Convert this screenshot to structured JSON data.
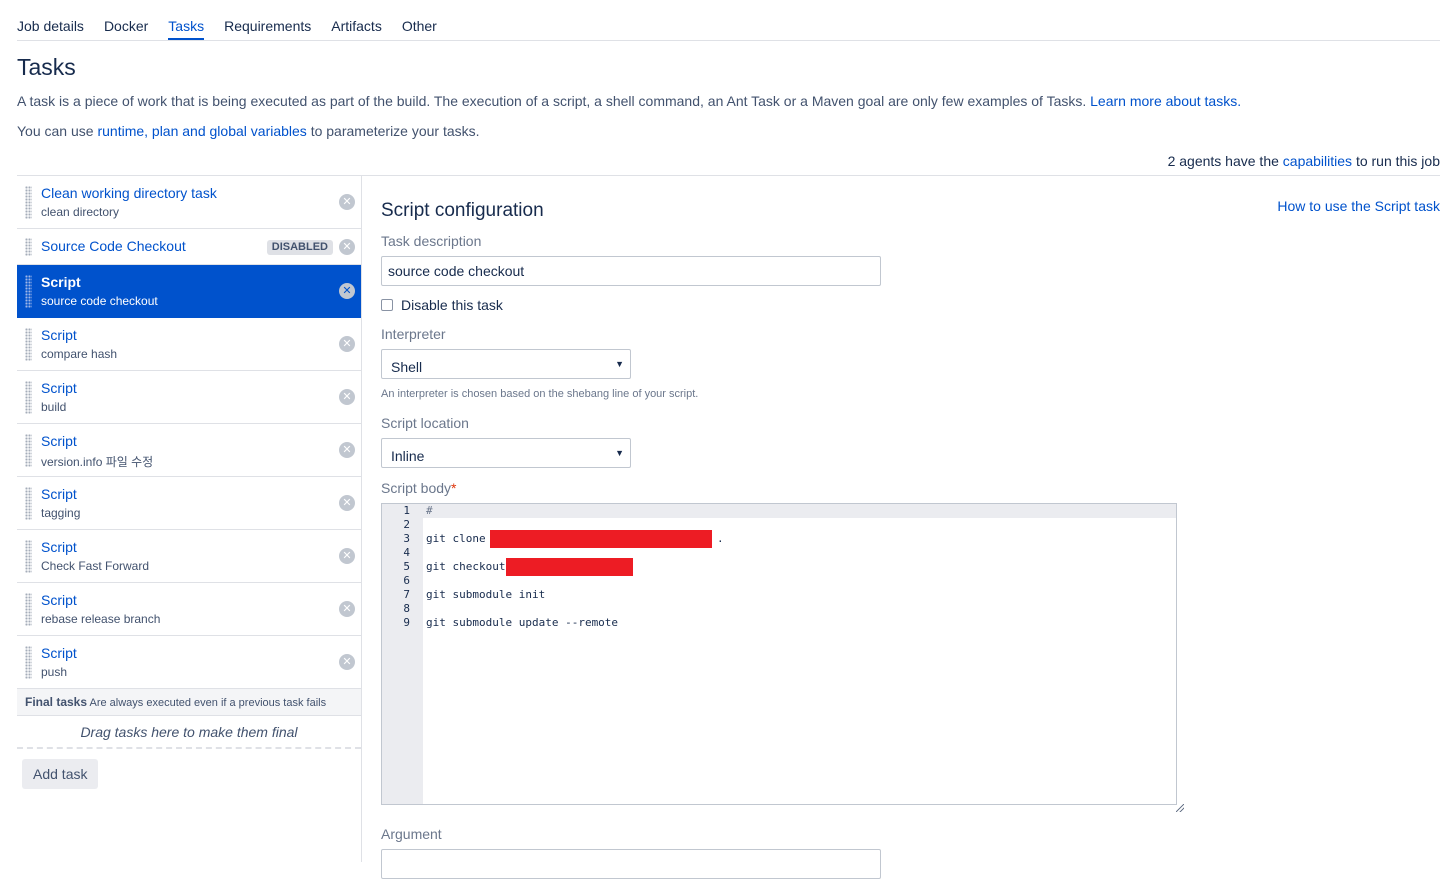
{
  "tabs": [
    {
      "label": "Job details"
    },
    {
      "label": "Docker"
    },
    {
      "label": "Tasks",
      "active": true
    },
    {
      "label": "Requirements"
    },
    {
      "label": "Artifacts"
    },
    {
      "label": "Other"
    }
  ],
  "page": {
    "title": "Tasks",
    "description": "A task is a piece of work that is being executed as part of the build. The execution of a script, a shell command, an Ant Task or a Maven goal are only few examples of Tasks.",
    "learn_more_link": "Learn more about tasks.",
    "variables_prefix": "You can use",
    "variables_link": "runtime, plan and global variables",
    "variables_suffix": "to parameterize your tasks.",
    "agents_prefix": "2 agents have the",
    "agents_link": "capabilities",
    "agents_suffix": "to run this job"
  },
  "tasks": [
    {
      "name": "Clean working directory task",
      "desc": "clean directory"
    },
    {
      "name": "Source Code Checkout",
      "desc": "",
      "badge": "DISABLED"
    },
    {
      "name": "Script",
      "desc": "source code checkout",
      "selected": true
    },
    {
      "name": "Script",
      "desc": "compare hash"
    },
    {
      "name": "Script",
      "desc": "build"
    },
    {
      "name": "Script",
      "desc": "version.info 파일 수정"
    },
    {
      "name": "Script",
      "desc": "tagging"
    },
    {
      "name": "Script",
      "desc": "Check Fast Forward"
    },
    {
      "name": "Script",
      "desc": "rebase release branch"
    },
    {
      "name": "Script",
      "desc": "push"
    }
  ],
  "final_tasks": {
    "title": "Final tasks",
    "note": "Are always executed even if a previous task fails",
    "drop_hint": "Drag tasks here to make them final"
  },
  "add_task_label": "Add task",
  "config": {
    "title": "Script configuration",
    "help_link": "How to use the Script task",
    "task_description_label": "Task description",
    "task_description_value": "source code checkout",
    "disable_label": "Disable this task",
    "interpreter_label": "Interpreter",
    "interpreter_value": "Shell",
    "interpreter_hint": "An interpreter is chosen based on the shebang line of your script.",
    "script_location_label": "Script location",
    "script_location_value": "Inline",
    "script_body_label": "Script body",
    "required_marker": "*",
    "argument_label": "Argument",
    "script_lines": [
      {
        "n": "1",
        "text": "#"
      },
      {
        "n": "2",
        "text": ""
      },
      {
        "n": "3",
        "text": "git clone"
      },
      {
        "n": "4",
        "text": ""
      },
      {
        "n": "5",
        "text": "git checkout"
      },
      {
        "n": "6",
        "text": ""
      },
      {
        "n": "7",
        "text": "git submodule init"
      },
      {
        "n": "8",
        "text": ""
      },
      {
        "n": "9",
        "text": "git submodule update --remote"
      }
    ],
    "line3_trailing": "."
  },
  "icons": {
    "remove": "close-circle-icon",
    "drag": "drag-handle-icon",
    "dropdown": "chevron-down-icon"
  },
  "colors": {
    "link": "#0052cc",
    "selected_bg": "#0052cc",
    "redaction": "#ed1c24"
  }
}
